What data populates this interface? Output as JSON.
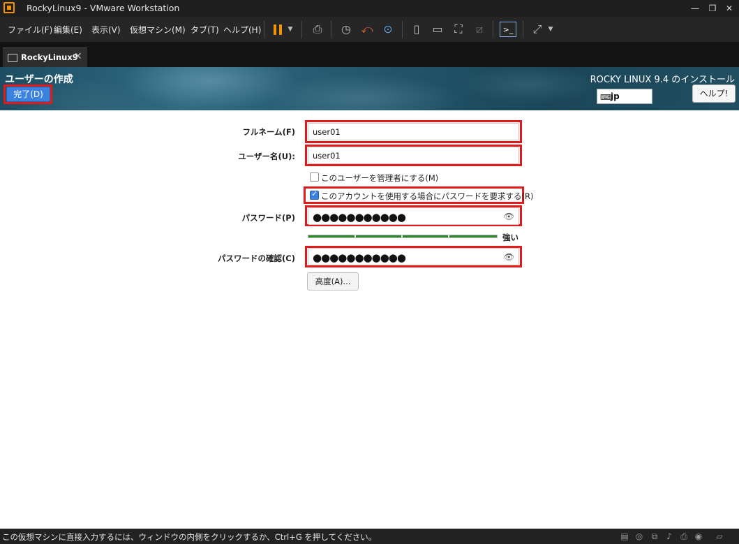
{
  "window": {
    "title": "RockyLinux9 - VMware Workstation",
    "controls": [
      "minimize-icon",
      "restore-icon",
      "close-icon"
    ]
  },
  "menu": {
    "items": [
      {
        "label": "ファイル(F)"
      },
      {
        "label": "編集(E)"
      },
      {
        "label": "表示(V)"
      },
      {
        "label": "仮想マシン(M)"
      },
      {
        "label": "タブ(T)"
      },
      {
        "label": "ヘルプ(H)"
      }
    ]
  },
  "toolbar": {
    "icons": [
      "pause-icon",
      "send-keys-icon",
      "snapshot-icon",
      "revert-snapshot-icon",
      "snapshot-manager-icon",
      "library-icon",
      "thumbnail-bar-icon",
      "full-screen-icon",
      "unity-icon",
      "console-view-icon",
      "stretch-guest-icon"
    ],
    "accent": "#f39200"
  },
  "tabs": [
    {
      "label": "RockyLinux9",
      "active": true
    }
  ],
  "installer": {
    "page_heading": "ユーザーの作成",
    "done_button": "完了(D)",
    "install_title": "ROCKY LINUX 9.4 のインストール",
    "keyboard_layout": "jp",
    "help_button": "ヘルプ!",
    "form": {
      "fullname_label": "フルネーム(F)",
      "fullname_value": "user01",
      "username_label": "ユーザー名(U):",
      "username_value": "user01",
      "admin_checkbox_label": "このユーザーを管理者にする(M)",
      "admin_checked": false,
      "require_password_label": "このアカウントを使用する場合にパスワードを要求する(R)",
      "require_password_checked": true,
      "password_label": "パスワード(P)",
      "password_mask": "●●●●●●●●●●●",
      "strength_fraction": 1.0,
      "strength_label": "強い",
      "confirm_label": "パスワードの確認(C)",
      "confirm_mask": "●●●●●●●●●●●",
      "advanced_button": "高度(A)..."
    },
    "highlight_color": "#e01b1b",
    "accent_color": "#3b82e0"
  },
  "statusbar": {
    "message": "この仮想マシンに直接入力するには、ウィンドウの内側をクリックするか、Ctrl+G を押してください。",
    "icons": [
      "hard-disk-icon",
      "cd-dvd-icon",
      "network-icon",
      "sound-icon",
      "printer-icon",
      "usb-icon",
      "message-icon"
    ]
  }
}
